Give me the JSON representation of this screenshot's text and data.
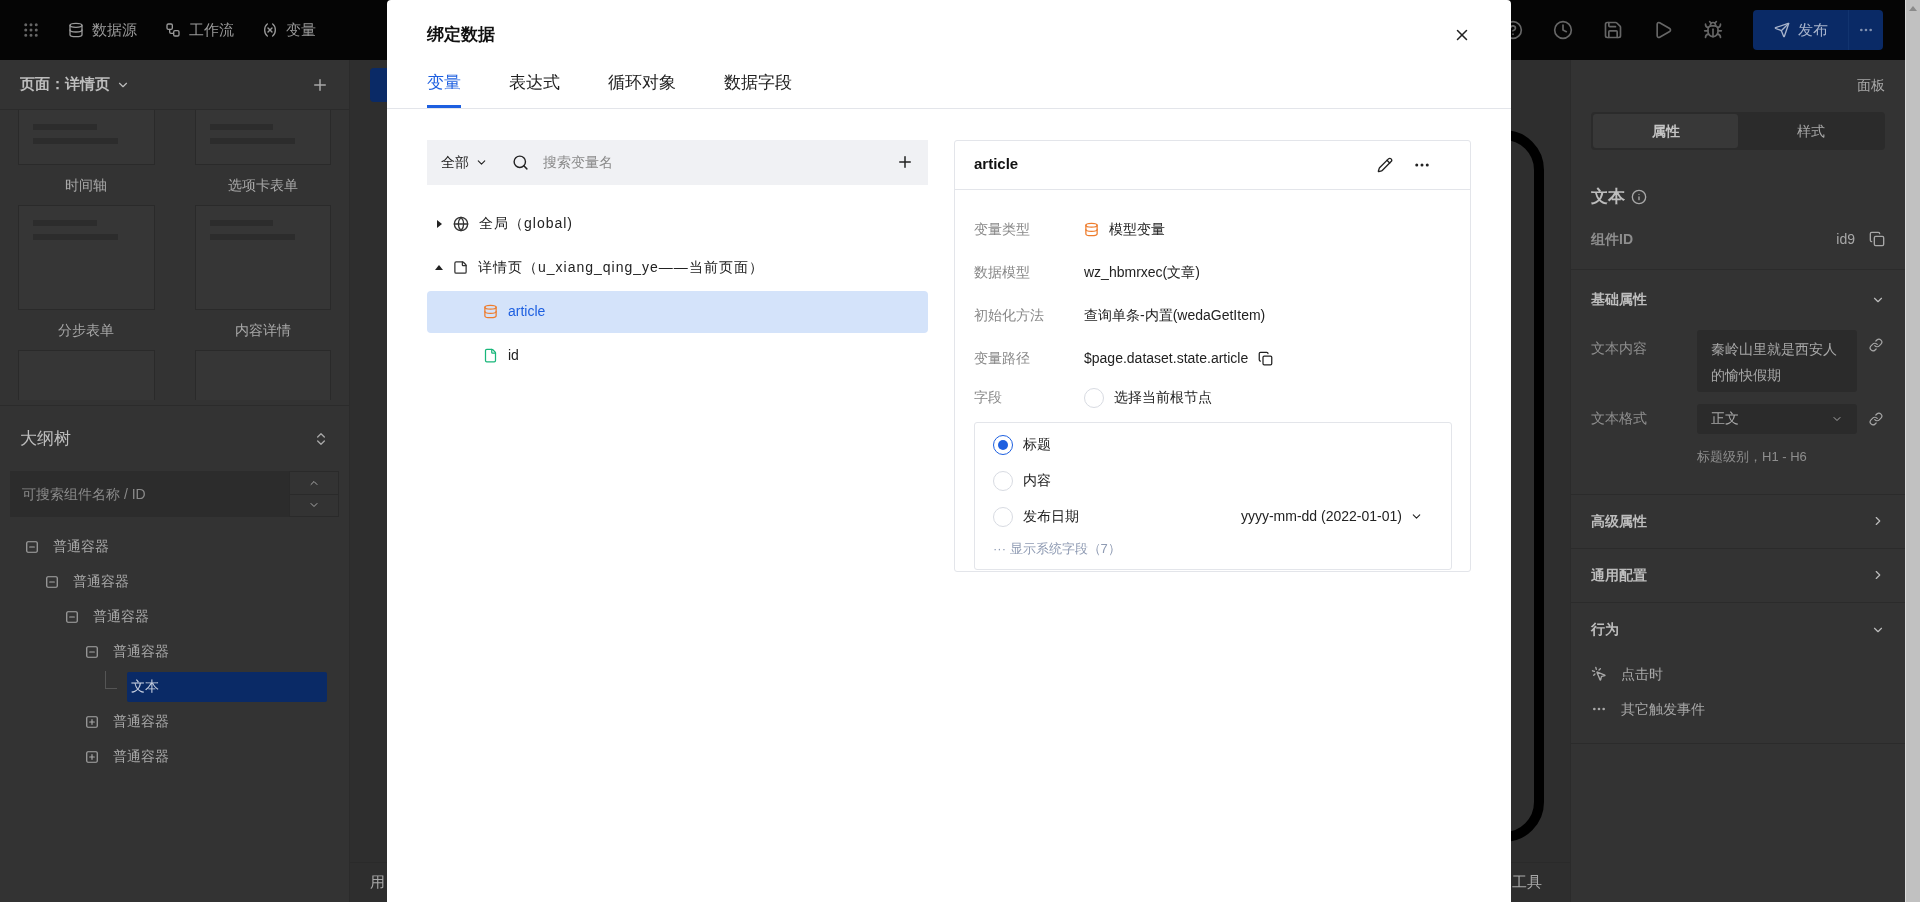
{
  "top_bar": {
    "nav": [
      "数据源",
      "工作流",
      "变量"
    ],
    "publish_button": "发布"
  },
  "left_panel": {
    "page_selector": "页面：详情页",
    "templates": [
      {
        "label": "时间轴"
      },
      {
        "label": "选项卡表单"
      },
      {
        "label": "分步表单"
      },
      {
        "label": "内容详情"
      }
    ],
    "outline": {
      "title": "大纲树",
      "search": {
        "placeholder": "可搜索组件名称 / ID"
      },
      "tree": [
        {
          "label": "普通容器",
          "expanded": true,
          "selected": false,
          "children": [
            {
              "label": "普通容器",
              "expanded": true,
              "selected": false,
              "children": [
                {
                  "label": "普通容器",
                  "expanded": true,
                  "selected": false,
                  "children": [
                    {
                      "label": "普通容器",
                      "expanded": true,
                      "selected": false,
                      "children": [
                        {
                          "label": "文本",
                          "selected": true
                        }
                      ]
                    },
                    {
                      "label": "普通容器",
                      "expanded": false,
                      "selected": false
                    },
                    {
                      "label": "普通容器",
                      "expanded": false,
                      "selected": false
                    }
                  ]
                }
              ]
            }
          ]
        }
      ]
    }
  },
  "canvas": {
    "bottom_left": "用",
    "bottom_right": "工具"
  },
  "right_panel": {
    "header": "面板",
    "tabs": [
      {
        "label": "属性",
        "selected": true
      },
      {
        "label": "样式",
        "selected": false
      }
    ],
    "component_title": "文本",
    "component_id": {
      "label": "组件ID",
      "value": "id9"
    },
    "basic_section": {
      "title": "基础属性",
      "expanded": true,
      "text_content": {
        "label": "文本内容",
        "value": "秦岭山里就是西安人的愉快假期"
      },
      "text_format": {
        "label": "文本格式",
        "value": "正文",
        "hint": "标题级别，H1 - H6"
      }
    },
    "collapsed_sections": [
      {
        "title": "高级属性",
        "expanded": false
      },
      {
        "title": "通用配置",
        "expanded": false
      }
    ],
    "behavior_section": {
      "title": "行为",
      "expanded": true,
      "events": [
        {
          "label": "点击时",
          "kind": "click"
        },
        {
          "label": "其它触发事件",
          "kind": "other"
        }
      ]
    }
  },
  "dialog": {
    "title": "绑定数据",
    "tabs": [
      {
        "label": "变量",
        "selected": true
      },
      {
        "label": "表达式",
        "selected": false
      },
      {
        "label": "循环对象",
        "selected": false
      },
      {
        "label": "数据字段",
        "selected": false
      }
    ],
    "filter": "全部",
    "search": {
      "placeholder": "搜索变量名"
    },
    "tree": [
      {
        "label": "全局（global)",
        "kind": "global",
        "expanded": false,
        "selected": false
      },
      {
        "label": "详情页（u_xiang_qing_ye——当前页面）",
        "kind": "page",
        "expanded": true,
        "selected": false,
        "children": [
          {
            "label": "article",
            "kind": "model",
            "selected": true
          },
          {
            "label": "id",
            "kind": "param",
            "selected": false
          }
        ]
      }
    ],
    "detail": {
      "title": "article",
      "rows": [
        {
          "label": "变量类型",
          "value": "模型变量",
          "kind": "type"
        },
        {
          "label": "数据模型",
          "value": "wz_hbmrxec(文章)",
          "kind": "text"
        },
        {
          "label": "初始化方法",
          "value": "查询单条-内置(wedaGetItem)",
          "kind": "text"
        },
        {
          "label": "变量路径",
          "value": "$page.dataset.state.article",
          "kind": "path"
        }
      ],
      "fields": {
        "label": "字段",
        "root_option": {
          "label": "选择当前根节点",
          "selected": false
        },
        "items": [
          {
            "label": "标题",
            "selected": true
          },
          {
            "label": "内容",
            "selected": false
          },
          {
            "label": "发布日期",
            "selected": false,
            "format": "yyyy-mm-dd (2022-01-01)"
          }
        ],
        "more": "··· 显示系统字段（7）"
      }
    }
  }
}
